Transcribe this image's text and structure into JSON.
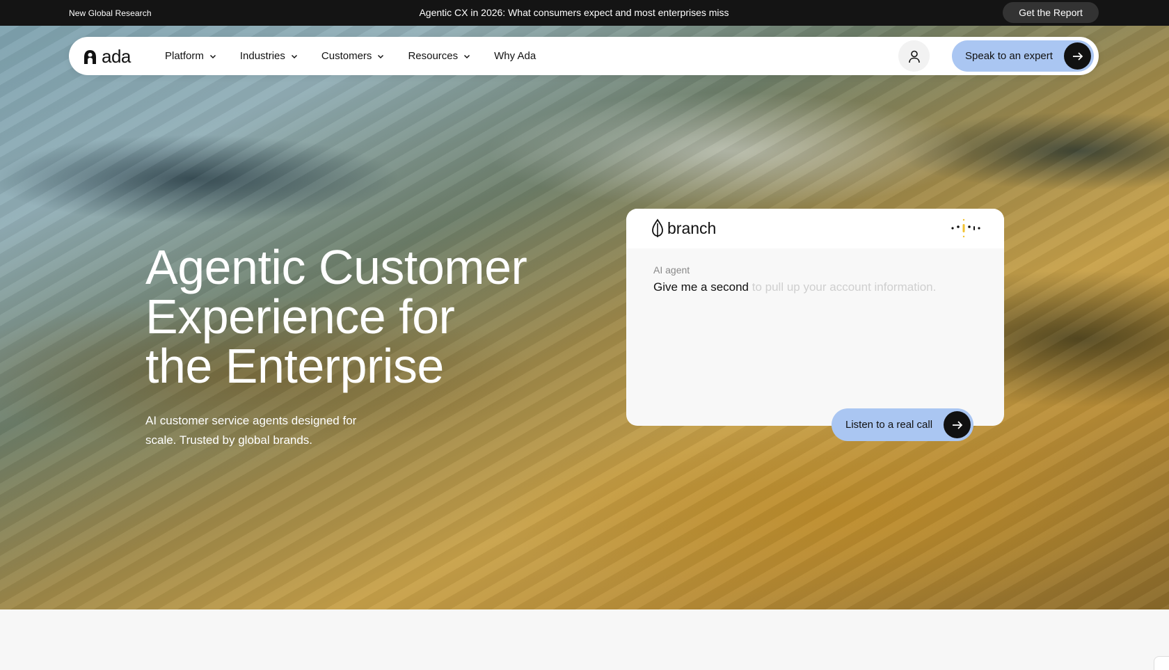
{
  "topbar": {
    "left_label": "New Global Research",
    "announcement": "Agentic CX in 2026: What consumers expect and most enterprises miss",
    "cta_label": "Get the Report"
  },
  "nav": {
    "logo_text": "ada",
    "items": [
      {
        "label": "Platform",
        "has_dropdown": true
      },
      {
        "label": "Industries",
        "has_dropdown": true
      },
      {
        "label": "Customers",
        "has_dropdown": true
      },
      {
        "label": "Resources",
        "has_dropdown": true
      },
      {
        "label": "Why Ada",
        "has_dropdown": false
      }
    ],
    "account_icon": "user-icon",
    "cta_label": "Speak to an expert"
  },
  "hero": {
    "headline_line1": "Agentic Customer",
    "headline_line2": "Experience for",
    "headline_line3": "the Enterprise",
    "subcopy": "AI customer service agents designed for scale. Trusted by global brands."
  },
  "card": {
    "brand_name": "branch",
    "agent_label": "AI agent",
    "message_spoken": "Give me a second",
    "message_pending": " to pull up your account information.",
    "listen_label": "Listen to a real call"
  },
  "colors": {
    "topbar_bg": "#141414",
    "accent_blue": "#aac6f2",
    "button_dark": "#111111",
    "voice_yellow": "#f2c230"
  }
}
